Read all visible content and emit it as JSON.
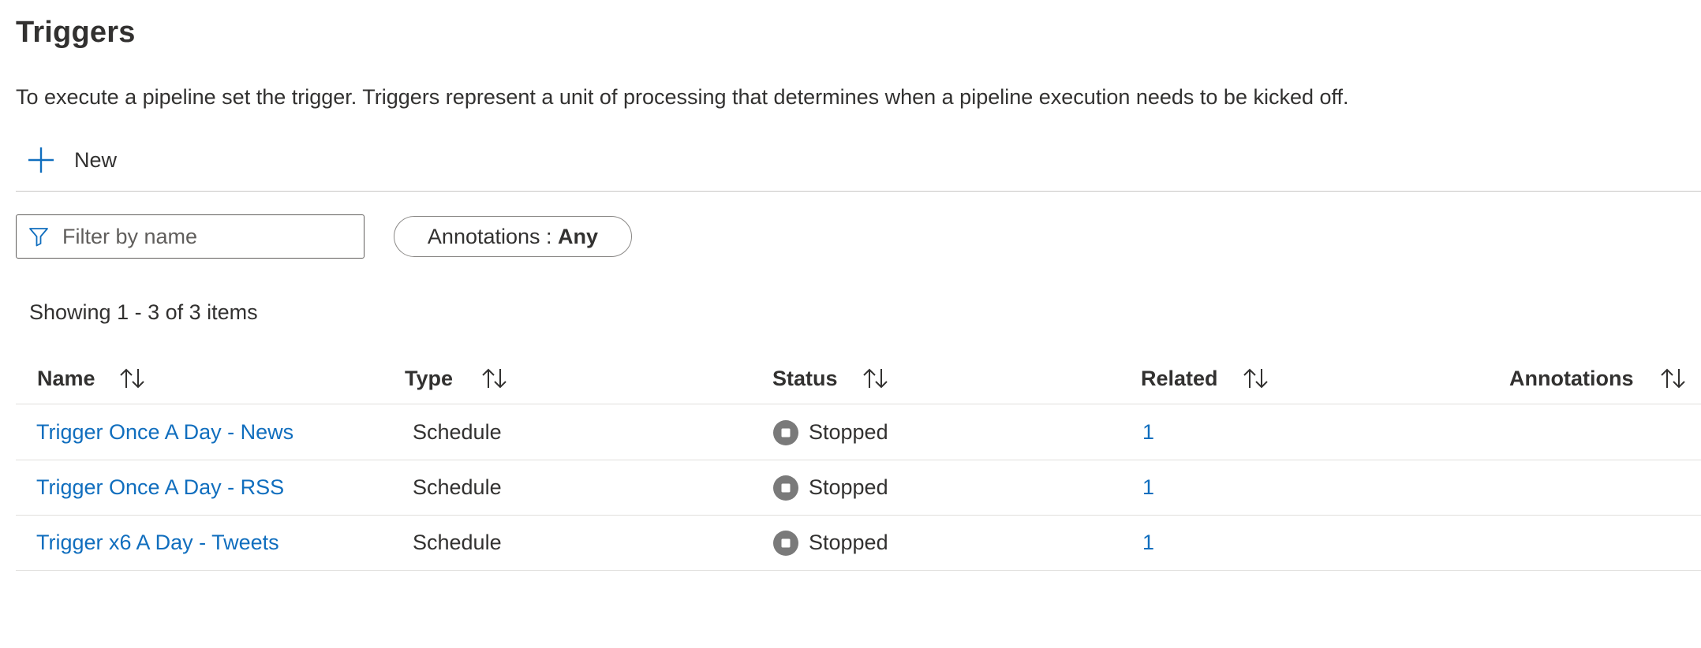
{
  "page": {
    "title": "Triggers",
    "description": "To execute a pipeline set the trigger. Triggers represent a unit of processing that determines when a pipeline execution needs to be kicked off."
  },
  "toolbar": {
    "new_label": "New",
    "new_icon": "plus-icon"
  },
  "filter": {
    "placeholder": "Filter by name",
    "icon": "filter-icon"
  },
  "annotations_filter": {
    "label": "Annotations : ",
    "value": "Any"
  },
  "summary": "Showing 1 - 3 of 3 items",
  "columns": [
    "Name",
    "Type",
    "Status",
    "Related",
    "Annotations"
  ],
  "rows": [
    {
      "name": "Trigger Once A Day - News",
      "type": "Schedule",
      "status": "Stopped",
      "related": "1",
      "annotations": ""
    },
    {
      "name": "Trigger Once A Day - RSS",
      "type": "Schedule",
      "status": "Stopped",
      "related": "1",
      "annotations": ""
    },
    {
      "name": "Trigger x6 A Day - Tweets",
      "type": "Schedule",
      "status": "Stopped",
      "related": "1",
      "annotations": ""
    }
  ],
  "colors": {
    "accent": "#106ebe",
    "status_stopped": "#7a7a7a",
    "text": "#323130",
    "divider": "#e1dfdd"
  }
}
